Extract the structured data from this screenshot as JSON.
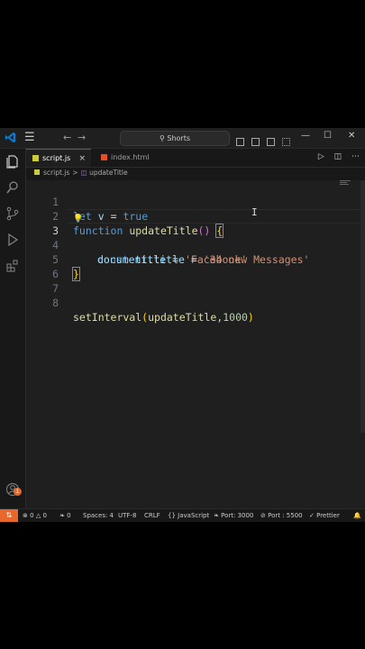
{
  "titlebar": {
    "menu_icon": "hamburger-icon",
    "back_icon": "arrow-left-icon",
    "forward_icon": "arrow-right-icon",
    "search_label": "Shorts",
    "layout_icons": [
      "toggle-sidebar-icon",
      "toggle-panel-icon",
      "toggle-secondary-sidebar-icon",
      "customize-layout-icon"
    ],
    "window_controls": [
      "minimize-icon",
      "maximize-icon",
      "close-icon"
    ]
  },
  "activity": [
    "explorer-icon",
    "search-icon",
    "source-control-icon",
    "run-debug-icon",
    "extensions-icon",
    "accounts-icon",
    "settings-icon"
  ],
  "accounts_badge": "1",
  "tabs": [
    {
      "label": "script.js",
      "active": true
    },
    {
      "label": "index.html",
      "active": false
    }
  ],
  "tab_close": "×",
  "breadcrumb": {
    "file": "script.js",
    "symbol": "updateTitle",
    "separator": ">"
  },
  "editor": {
    "lines": [
      {
        "num": "1"
      },
      {
        "num": "2"
      },
      {
        "num": "3"
      },
      {
        "num": "4"
      },
      {
        "num": "5"
      },
      {
        "num": "6"
      },
      {
        "num": "7"
      },
      {
        "num": "8"
      }
    ],
    "tokens": {
      "l1_let": "let",
      "l1_v": "v",
      "l1_eq": " = ",
      "l1_true": "true",
      "l2_function": "function",
      "l2_name": "updateTitle",
      "l2_paren": "()",
      "l2_brace": "{",
      "l3_const": "const",
      "l3_title": "title",
      "l3_eq": " = ",
      "l3_str": "'Facebook'",
      "l4_document": "document",
      "l4_dot": ".",
      "l4_title": "title",
      "l4_eq": " = ",
      "l4_str": "'34 new Messages'",
      "l5_brace": "}",
      "l8_fn": "setInterval",
      "l8_open": "(",
      "l8_arg": "updateTitle",
      "l8_comma": ",",
      "l8_num": "1000",
      "l8_close": ")"
    }
  },
  "status": {
    "errors": "0",
    "warnings": "0",
    "ports": "0",
    "spaces": "Spaces: 4",
    "encoding": "UTF-8",
    "eol": "CRLF",
    "language": "JavaScript",
    "port1": "Port: 3000",
    "port2": "Port : 5500",
    "prettier": "Prettier"
  }
}
